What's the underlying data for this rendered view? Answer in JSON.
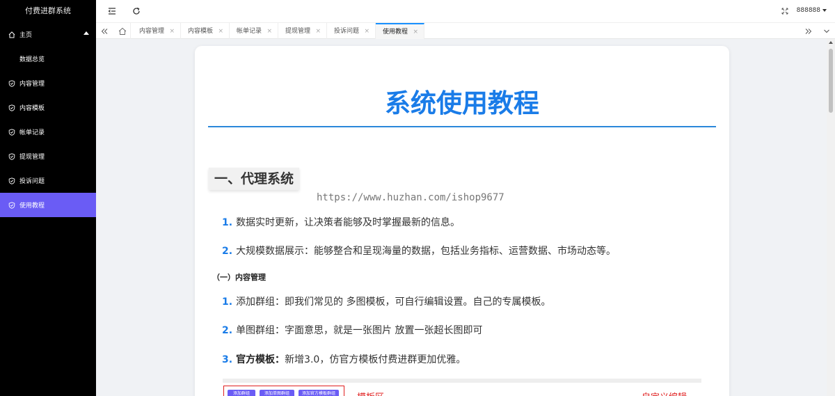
{
  "sidebar": {
    "brand": "付费进群系统",
    "items": [
      {
        "label": "主页",
        "icon": "home-icon"
      },
      {
        "label": "数据总览"
      },
      {
        "label": "内容管理",
        "icon": "shield-check-icon"
      },
      {
        "label": "内容模板",
        "icon": "shield-check-icon"
      },
      {
        "label": "帐单记录",
        "icon": "shield-check-icon"
      },
      {
        "label": "提现管理",
        "icon": "shield-check-icon"
      },
      {
        "label": "投诉问题",
        "icon": "shield-check-icon"
      },
      {
        "label": "使用教程",
        "icon": "shield-check-icon",
        "active": true
      }
    ]
  },
  "topbar": {
    "user": "888888"
  },
  "tabs": [
    {
      "label": "内容管理"
    },
    {
      "label": "内容模板"
    },
    {
      "label": "帐单记录"
    },
    {
      "label": "提现管理"
    },
    {
      "label": "投诉问题"
    },
    {
      "label": "使用教程",
      "active": true
    }
  ],
  "tab_close": "×",
  "colors": {
    "accent": "#6a5cf5",
    "title_blue": "#1a7ce8",
    "red": "#e01e1e"
  },
  "doc": {
    "title": "系统使用教程",
    "section1": "一、代理系统",
    "watermark": "https://www.huzhan.com/ishop9677",
    "list1": [
      {
        "num": "1.",
        "text": "数据实时更新，让决策者能够及时掌握最新的信息。"
      },
      {
        "num": "2.",
        "text": "大规模数据展示：能够整合和呈现海量的数据，包括业务指标、运营数据、市场动态等。"
      }
    ],
    "subsection": "（一）内容管理",
    "list2": [
      {
        "num": "1.",
        "text": "添加群组：即我们常见的 多图模板，可自行编辑设置。自己的专属模板。"
      },
      {
        "num": "2.",
        "text": "单图群组：字面意思，就是一张图片 放置一张超长图即可"
      },
      {
        "num": "3.",
        "bold": "官方模板：",
        "text": "新增3.0，仿官方模板付费进群更加优雅。"
      }
    ],
    "screenshot": {
      "buttons": [
        "添加群组",
        "添加单图群组",
        "添加官方模板群组"
      ],
      "label_left": "模板区",
      "label_right": "自定义编辑"
    }
  }
}
